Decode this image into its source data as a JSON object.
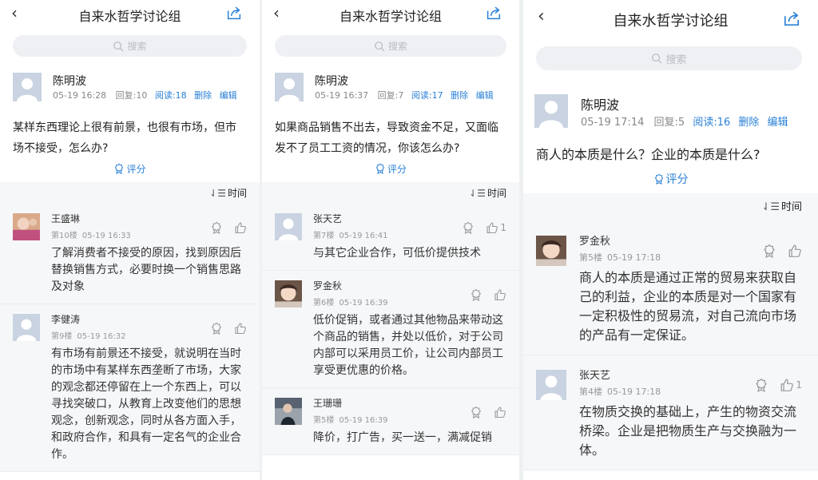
{
  "colors": {
    "accent": "#2a80d6",
    "muted": "#888888",
    "band": "#f6f7f9"
  },
  "panels": [
    {
      "title": "自来水哲学讨论组",
      "search_placeholder": "搜索",
      "author": {
        "name": "陈明波",
        "datetime": "05-19 16:28",
        "replies": "回复:10",
        "reads": "阅读:18",
        "delete": "删除",
        "edit": "编辑"
      },
      "question": "某样东西理论上很有前景，也很有市场，但市场不接受，怎么办?",
      "rate_label": "评分",
      "sort_label": "时间",
      "comments": [
        {
          "name": "王盛琳",
          "floor": "第10楼",
          "time": "05-19 16:33",
          "text": "了解消费者不接受的原因，找到原因后替换销售方式，必要时换一个销售思路及对象",
          "likes": ""
        },
        {
          "name": "李健涛",
          "floor": "第9楼",
          "time": "05-19 16:32",
          "text": "有市场有前景还不接受，就说明在当时的市场中有某样东西垄断了市场，大家的观念都还停留在上一个东西上，可以寻找突破口，从教育上改变他们的思想观念，创新观念，同时从各方面入手，和政府合作，和具有一定名气的企业合作。",
          "likes": ""
        }
      ]
    },
    {
      "title": "自来水哲学讨论组",
      "search_placeholder": "搜索",
      "author": {
        "name": "陈明波",
        "datetime": "05-19 16:37",
        "replies": "回复:7",
        "reads": "阅读:17",
        "delete": "删除",
        "edit": "编辑"
      },
      "question": "如果商品销售不出去，导致资金不足，又面临发不了员工工资的情况，你该怎么办?",
      "rate_label": "评分",
      "sort_label": "时间",
      "comments": [
        {
          "name": "张天艺",
          "floor": "第7楼",
          "time": "05-19 16:41",
          "text": "与其它企业合作，可低价提供技术",
          "likes": "1"
        },
        {
          "name": "罗金秋",
          "floor": "第6楼",
          "time": "05-19 16:39",
          "text": "低价促销，或者通过其他物品来带动这个商品的销售，并处以低价，对于公司内部可以采用员工价，让公司内部员工享受更优惠的价格。",
          "likes": ""
        },
        {
          "name": "王珊珊",
          "floor": "第5楼",
          "time": "05-19 16:39",
          "text": "降价，打广告，买一送一，满减促销",
          "likes": ""
        }
      ]
    },
    {
      "title": "自来水哲学讨论组",
      "search_placeholder": "搜索",
      "author": {
        "name": "陈明波",
        "datetime": "05-19 17:14",
        "replies": "回复:5",
        "reads": "阅读:16",
        "delete": "删除",
        "edit": "编辑"
      },
      "question": "商人的本质是什么？企业的本质是什么?",
      "rate_label": "评分",
      "sort_label": "时间",
      "comments": [
        {
          "name": "罗金秋",
          "floor": "第5楼",
          "time": "05-19 17:18",
          "text": "商人的本质是通过正常的贸易来获取自己的利益，企业的本质是对一个国家有一定积极性的贸易流，对自己流向市场的产品有一定保证。",
          "likes": ""
        },
        {
          "name": "张天艺",
          "floor": "第4楼",
          "time": "05-19 17:18",
          "text": "在物质交换的基础上，产生的物资交流桥梁。企业是把物质生产与交换融为一体。",
          "likes": "1"
        }
      ]
    }
  ]
}
